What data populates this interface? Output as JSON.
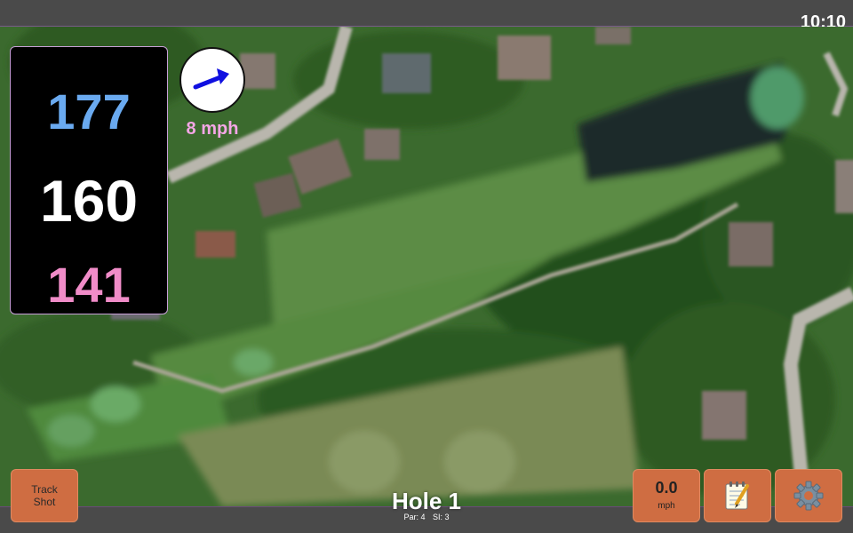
{
  "status": {
    "clock": "10:10"
  },
  "distances": {
    "back": "177",
    "middle": "160",
    "front": "141"
  },
  "wind": {
    "speed_label": "8 mph"
  },
  "hole": {
    "title": "Hole 1",
    "par_label": "Par: 4",
    "si_label": "SI: 3"
  },
  "buttons": {
    "track_shot": "Track Shot",
    "speed_value": "0.0",
    "speed_unit": "mph",
    "notes_icon": "notepad-icon",
    "settings_icon": "gear-icon"
  },
  "colors": {
    "back_distance": "#6aaaf0",
    "middle_distance": "#ffffff",
    "front_distance": "#f08cc8",
    "button": "#cf6d42",
    "wind_arrow": "#1010e0"
  }
}
